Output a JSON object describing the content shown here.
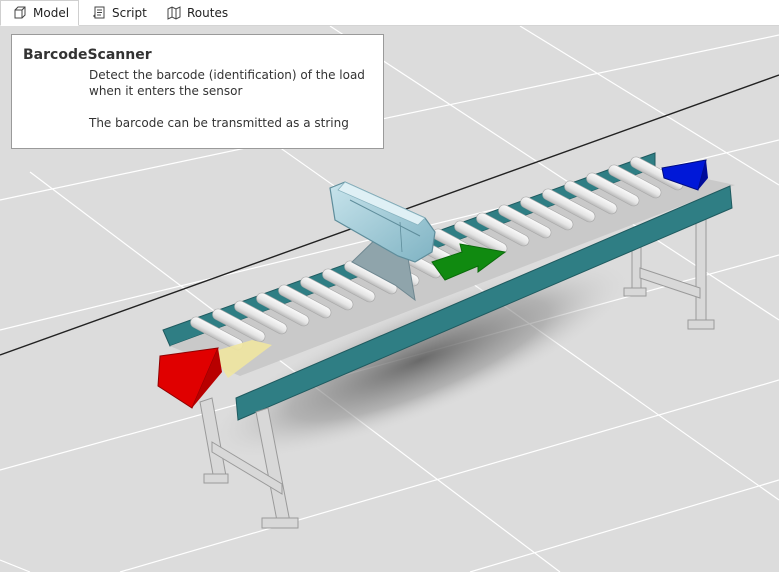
{
  "tabs": [
    {
      "label": "Model",
      "icon": "cube-icon",
      "active": true
    },
    {
      "label": "Script",
      "icon": "script-icon",
      "active": false
    },
    {
      "label": "Routes",
      "icon": "map-icon",
      "active": false
    }
  ],
  "tooltip": {
    "title": "BarcodeScanner",
    "description": "Detect the barcode (identification) of the load when it enters the sensor",
    "note": "The barcode can be transmitted as a string"
  },
  "scene": {
    "colors": {
      "floor": "#dcdcdc",
      "grid": "#ffffff",
      "belt": "#2f7e84",
      "roller": "#ebebeb",
      "scanner": "#a9d0dc",
      "entry_arrow": "#e00000",
      "exit_arrow": "#0018d8",
      "direction_arrow": "#108a10",
      "sensor_marker": "#f0e6a0"
    }
  }
}
